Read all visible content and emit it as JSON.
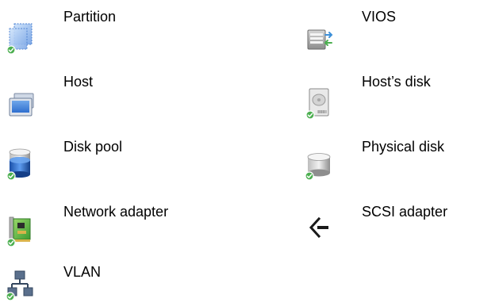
{
  "legend": {
    "items": [
      {
        "key": "partition",
        "label": "Partition",
        "icon": "partition-icon",
        "status": "ok"
      },
      {
        "key": "vios",
        "label": "VIOS",
        "icon": "vios-icon",
        "status": "none"
      },
      {
        "key": "host",
        "label": "Host",
        "icon": "host-icon",
        "status": "none"
      },
      {
        "key": "hosts_disk",
        "label": "Host’s disk",
        "icon": "hosts-disk-icon",
        "status": "ok"
      },
      {
        "key": "disk_pool",
        "label": "Disk pool",
        "icon": "disk-pool-icon",
        "status": "ok"
      },
      {
        "key": "physical_disk",
        "label": "Physical disk",
        "icon": "physical-disk-icon",
        "status": "ok"
      },
      {
        "key": "network_adapter",
        "label": "Network adapter",
        "icon": "network-adapter-icon",
        "status": "ok"
      },
      {
        "key": "scsi_adapter",
        "label": "SCSI adapter",
        "icon": "scsi-adapter-icon",
        "status": "none"
      },
      {
        "key": "vlan",
        "label": "VLAN",
        "icon": "vlan-icon",
        "status": "ok"
      }
    ]
  },
  "colors": {
    "status_ok": "#4caf50",
    "partition_blue": "#8fb8ec",
    "disk_blue": "#2a6fd1",
    "gray": "#9a9a9a"
  }
}
